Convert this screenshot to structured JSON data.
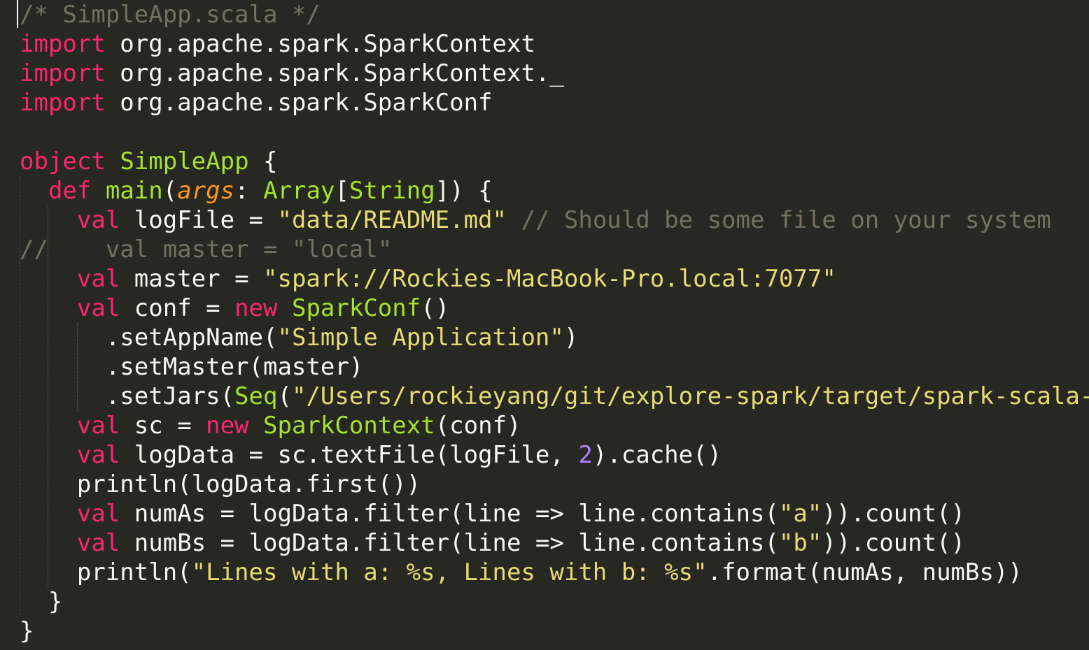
{
  "editor": {
    "theme_colors": {
      "background": "#272822",
      "foreground": "#F8F8F2",
      "comment": "#75715E",
      "keyword": "#F92672",
      "type": "#A6E22E",
      "string": "#E6DB74",
      "number": "#AE81FF",
      "parameter": "#FD971F"
    },
    "lines": [
      [
        {
          "t": "comment",
          "v": "/* SimpleApp.scala */"
        }
      ],
      [
        {
          "t": "keyword",
          "v": "import"
        },
        {
          "t": "plain",
          "v": " org.apache.spark.SparkContext"
        }
      ],
      [
        {
          "t": "keyword",
          "v": "import"
        },
        {
          "t": "plain",
          "v": " org.apache.spark.SparkContext._"
        }
      ],
      [
        {
          "t": "keyword",
          "v": "import"
        },
        {
          "t": "plain",
          "v": " org.apache.spark.SparkConf"
        }
      ],
      [],
      [
        {
          "t": "keyword",
          "v": "object"
        },
        {
          "t": "plain",
          "v": " "
        },
        {
          "t": "type",
          "v": "SimpleApp"
        },
        {
          "t": "plain",
          "v": " {"
        }
      ],
      [
        {
          "t": "plain",
          "v": "  "
        },
        {
          "t": "keyword",
          "v": "def"
        },
        {
          "t": "plain",
          "v": " "
        },
        {
          "t": "func",
          "v": "main"
        },
        {
          "t": "plain",
          "v": "("
        },
        {
          "t": "param",
          "v": "args"
        },
        {
          "t": "plain",
          "v": ": "
        },
        {
          "t": "type",
          "v": "Array"
        },
        {
          "t": "plain",
          "v": "["
        },
        {
          "t": "type",
          "v": "String"
        },
        {
          "t": "plain",
          "v": "]) {"
        }
      ],
      [
        {
          "t": "plain",
          "v": "    "
        },
        {
          "t": "keyword",
          "v": "val"
        },
        {
          "t": "plain",
          "v": " logFile = "
        },
        {
          "t": "string",
          "v": "\"data/README.md\""
        },
        {
          "t": "plain",
          "v": " "
        },
        {
          "t": "comment",
          "v": "// Should be some file on your system"
        }
      ],
      [
        {
          "t": "comment",
          "v": "//    val master = \"local\""
        }
      ],
      [
        {
          "t": "plain",
          "v": "    "
        },
        {
          "t": "keyword",
          "v": "val"
        },
        {
          "t": "plain",
          "v": " master = "
        },
        {
          "t": "string",
          "v": "\"spark://Rockies-MacBook-Pro.local:7077\""
        }
      ],
      [
        {
          "t": "plain",
          "v": "    "
        },
        {
          "t": "keyword",
          "v": "val"
        },
        {
          "t": "plain",
          "v": " conf = "
        },
        {
          "t": "keyword",
          "v": "new"
        },
        {
          "t": "plain",
          "v": " "
        },
        {
          "t": "type",
          "v": "SparkConf"
        },
        {
          "t": "plain",
          "v": "()"
        }
      ],
      [
        {
          "t": "plain",
          "v": "      .setAppName("
        },
        {
          "t": "string",
          "v": "\"Simple Application\""
        },
        {
          "t": "plain",
          "v": ")"
        }
      ],
      [
        {
          "t": "plain",
          "v": "      .setMaster(master)"
        }
      ],
      [
        {
          "t": "plain",
          "v": "      .setJars("
        },
        {
          "t": "type",
          "v": "Seq"
        },
        {
          "t": "plain",
          "v": "("
        },
        {
          "t": "string",
          "v": "\"/Users/rockieyang/git/explore-spark/target/spark-scala-"
        }
      ],
      [
        {
          "t": "plain",
          "v": "    "
        },
        {
          "t": "keyword",
          "v": "val"
        },
        {
          "t": "plain",
          "v": " sc = "
        },
        {
          "t": "keyword",
          "v": "new"
        },
        {
          "t": "plain",
          "v": " "
        },
        {
          "t": "type",
          "v": "SparkContext"
        },
        {
          "t": "plain",
          "v": "(conf)"
        }
      ],
      [
        {
          "t": "plain",
          "v": "    "
        },
        {
          "t": "keyword",
          "v": "val"
        },
        {
          "t": "plain",
          "v": " logData = sc.textFile(logFile, "
        },
        {
          "t": "number",
          "v": "2"
        },
        {
          "t": "plain",
          "v": ").cache()"
        }
      ],
      [
        {
          "t": "plain",
          "v": "    println(logData.first())"
        }
      ],
      [
        {
          "t": "plain",
          "v": "    "
        },
        {
          "t": "keyword",
          "v": "val"
        },
        {
          "t": "plain",
          "v": " numAs = logData.filter(line => line.contains("
        },
        {
          "t": "string",
          "v": "\"a\""
        },
        {
          "t": "plain",
          "v": ")).count()"
        }
      ],
      [
        {
          "t": "plain",
          "v": "    "
        },
        {
          "t": "keyword",
          "v": "val"
        },
        {
          "t": "plain",
          "v": " numBs = logData.filter(line => line.contains("
        },
        {
          "t": "string",
          "v": "\"b\""
        },
        {
          "t": "plain",
          "v": ")).count()"
        }
      ],
      [
        {
          "t": "plain",
          "v": "    println("
        },
        {
          "t": "string",
          "v": "\"Lines with a: %s, Lines with b: %s\""
        },
        {
          "t": "plain",
          "v": ".format(numAs, numBs))"
        }
      ],
      [
        {
          "t": "plain",
          "v": "  }"
        }
      ],
      [
        {
          "t": "plain",
          "v": "}"
        }
      ]
    ]
  }
}
